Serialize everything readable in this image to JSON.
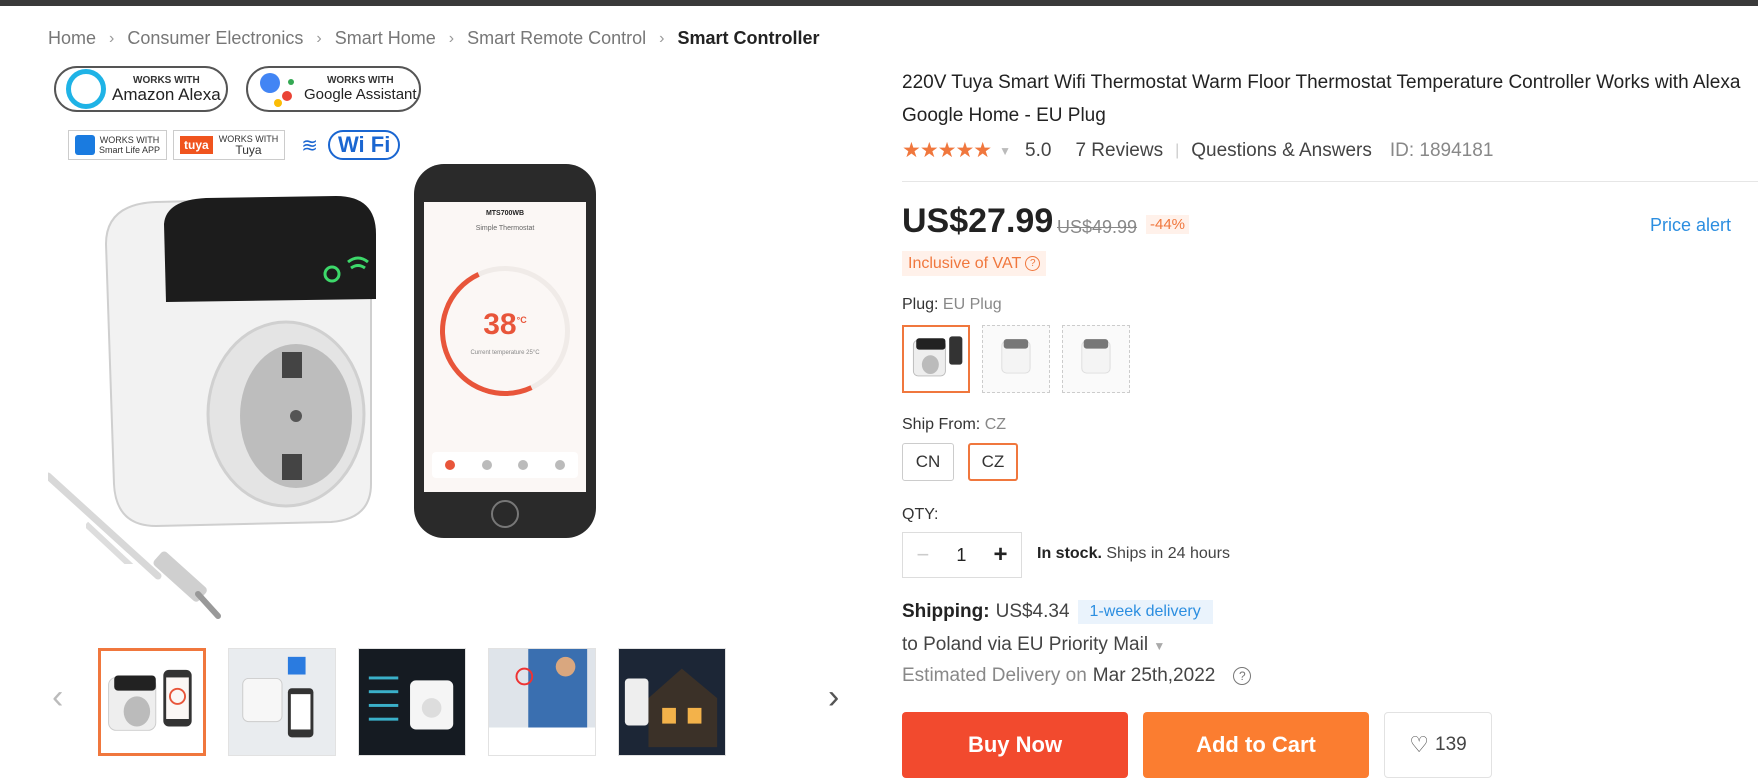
{
  "breadcrumb": {
    "items": [
      "Home",
      "Consumer Electronics",
      "Smart Home",
      "Smart Remote Control"
    ],
    "current": "Smart Controller"
  },
  "gallery": {
    "badges": {
      "alexa_small": "WORKS WITH",
      "alexa_big": "Amazon Alexa",
      "google_small": "WORKS WITH",
      "google_big": "Google Assistant",
      "smartlife_small": "WORKS WITH",
      "smartlife_big": "Smart Life APP",
      "tuya_logo": "tuya",
      "tuya_small": "WORKS WITH",
      "tuya_big": "Tuya",
      "wifi": "Wi Fi"
    },
    "phone": {
      "title": "MTS700WB",
      "subtitle": "Simple Thermostat",
      "temp": "38",
      "unit": "°C",
      "current": "Current temperature 25°C"
    },
    "prev_arrow": "‹",
    "next_arrow": "›"
  },
  "product": {
    "title": "220V Tuya Smart Wifi Thermostat Warm Floor Thermostat Temperature Controller Works with Alexa Google Home - EU Plug",
    "rating_stars": "★★★★★",
    "rating": "5.0",
    "reviews": "7 Reviews",
    "qa": "Questions & Answers",
    "id": "ID: 1894181"
  },
  "pricing": {
    "price": "US$27.99",
    "old_price": "US$49.99",
    "discount": "-44%",
    "price_alert": "Price alert",
    "vat": "Inclusive of VAT",
    "accent": "#f0773d"
  },
  "options": {
    "plug_label": "Plug:",
    "plug_value": "EU Plug",
    "ship_from_label": "Ship From:",
    "ship_from_value": "CZ",
    "ship_from_options": [
      "CN",
      "CZ"
    ],
    "qty_label": "QTY:",
    "qty_value": "1",
    "stock_bold": "In stock.",
    "stock_text": "Ships in 24 hours"
  },
  "shipping": {
    "label": "Shipping:",
    "amount": "US$4.34",
    "badge": "1-week delivery",
    "route": "to Poland via EU Priority Mail",
    "est_label": "Estimated Delivery on",
    "est_date": "Mar 25th,2022"
  },
  "actions": {
    "buy_now": "Buy Now",
    "add_to_cart": "Add to Cart",
    "wishlist_count": "139",
    "buy_color": "#f24a2e",
    "cart_color": "#fb7d30"
  }
}
